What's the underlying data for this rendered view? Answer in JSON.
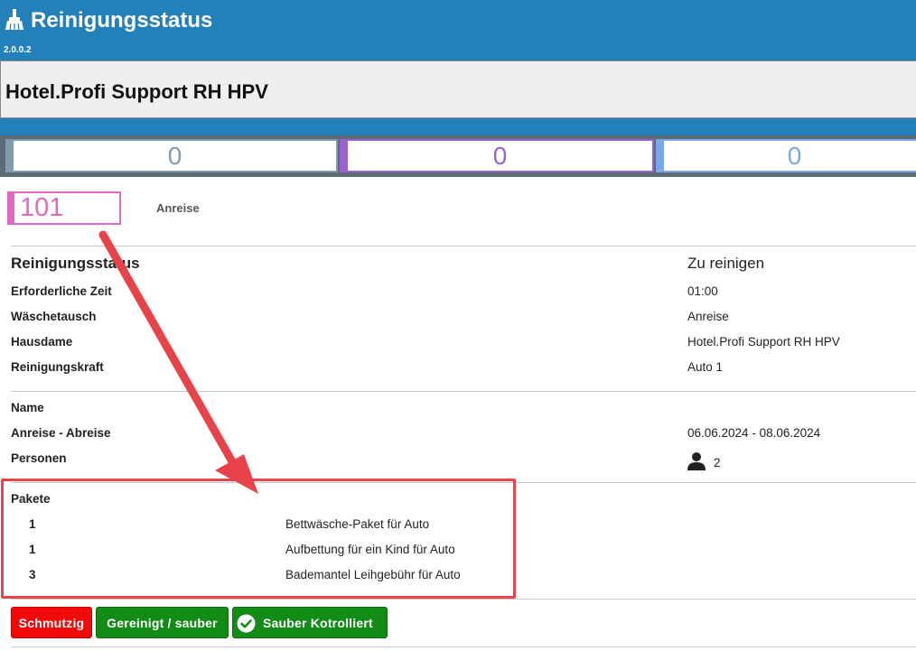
{
  "app": {
    "title": "Reinigungsstatus",
    "version": "2.0.0.2",
    "icon": "broom-icon"
  },
  "hotel": {
    "name": "Hotel.Profi Support RH HPV"
  },
  "counters": [
    {
      "value": "0",
      "color": "#7e9bb0"
    },
    {
      "value": "0",
      "color": "#9b62cf"
    },
    {
      "value": "0",
      "color": "#7aa7ea"
    }
  ],
  "room": {
    "number": "101",
    "status": "Anreise",
    "color": "#e069bf"
  },
  "cleaning": {
    "section_label": "Reinigungsstatus",
    "section_value": "Zu reinigen",
    "rows": [
      {
        "label": "Erforderliche Zeit",
        "value": "01:00"
      },
      {
        "label": "Wäschetausch",
        "value": "Anreise"
      },
      {
        "label": "Hausdame",
        "value": "Hotel.Profi Support RH HPV"
      },
      {
        "label": "Reinigungskraft",
        "value": "Auto 1"
      }
    ]
  },
  "guest": {
    "name_label": "Name",
    "name_value": "",
    "dates_label": "Anreise - Abreise",
    "dates_value": "06.06.2024 - 08.06.2024",
    "persons_label": "Personen",
    "persons_value": "2",
    "persons_icon": "person-icon"
  },
  "packages": {
    "label": "Pakete",
    "items": [
      {
        "qty": "1",
        "name": "Bettwäsche-Paket für Auto"
      },
      {
        "qty": "1",
        "name": "Aufbettung für ein Kind für Auto"
      },
      {
        "qty": "3",
        "name": "Bademantel Leihgebühr für Auto"
      }
    ]
  },
  "annotation": {
    "color": "#e8434a"
  },
  "actions": {
    "dirty_label": "Schmutzig",
    "clean_label": "Gereinigt / sauber",
    "checked_label": "Sauber Kotrolliert",
    "dirty_color": "#f00a0a",
    "clean_color": "#138b17"
  }
}
